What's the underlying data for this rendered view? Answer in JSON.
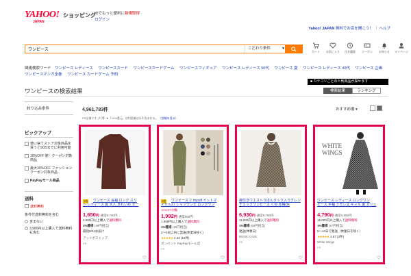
{
  "header": {
    "logo_text": "YAHOO!",
    "logo_sub": "JAPAN",
    "shop_label": "ショッピング",
    "login_prompt": "IDでもっと便利に",
    "register_link": "新規取得",
    "login_link": "ログイン",
    "yj_label": "Yahoo! JAPAN",
    "top_links": "無料でお店を開こう！",
    "help": "ヘルプ"
  },
  "search": {
    "value": "ワンピース",
    "condition_label": "こだわり条件",
    "icons": [
      {
        "icon": "cart-icon",
        "label": "カート"
      },
      {
        "icon": "heart-icon",
        "label": "お気に入り"
      },
      {
        "icon": "history-icon",
        "label": "注文履歴"
      },
      {
        "icon": "coupon-icon",
        "label": "クーポン"
      },
      {
        "icon": "bell-icon",
        "label": "お知らせ"
      },
      {
        "icon": "user-icon",
        "label": "マイページ"
      }
    ]
  },
  "related": {
    "label": "関連検索ワード",
    "words": [
      "ワンピース レディース",
      "ワンピースカード",
      "ワンピースカードゲーム",
      "ワンピースフィギュア",
      "ワンピース レディース 50代",
      "ワンピース 夏",
      "ワンピース レディース 40代",
      "ワンピース 企画",
      "ワンピースマンガ全巻",
      "ワンピース カードゲーム 予約"
    ]
  },
  "page": {
    "title": "ワンピースの検索結果",
    "notice": "カテゴリごとの人気商品が探せます",
    "tabs": [
      "検索結果",
      "ランキング"
    ],
    "count": "4,961,783件",
    "sort": "おすすめ順",
    "pr_line": "PR企業です | 行等: ★「10%還元」は利用者は分不含まれる。",
    "pr_line2": "（詳細を見る）"
  },
  "sidebar": {
    "filter_title": "絞り込み条件",
    "pickup_title": "ピックアップ",
    "pickup_items": [
      "使い捨てストア対象商品を買うと9/25までに利用可能",
      "10%OFF 使！クーポン対象商品",
      "最大30%OFF ファッションクーポン対象商品"
    ],
    "paypay": "PayPayモール商品",
    "ship_title": "送料",
    "ship_free": "送料無料",
    "ship_condition": "条件付送料無料を含む",
    "radio_items": [
      "含まない",
      "3,980円以上購入で送料無料も含む"
    ]
  },
  "products": [
    {
      "badge1": "1倍",
      "badge2": "送料",
      "title_line1": "ワンピース 長袖 ロング スリ",
      "title_line2": "ト レディース 夏 大人 きれいめ セー",
      "price": "1,650",
      "price_unit": "円",
      "was": "通常6,700円",
      "ship": "3,980円以上購入で",
      "ship_free": "送料無料",
      "points": "3%獲得",
      "points_detail": "(49円相当)",
      "delivery": "最短9/24お届け",
      "rating_stars": "",
      "rating_value": "",
      "rating_count": "",
      "store": "アッドボストップ",
      "pr": "PR"
    },
    {
      "badge1": "1倍",
      "badge2": "送料",
      "sale": "10%OFF対象",
      "title_line1": "ワンピース 1: mysdf イットマ",
      "title_line2": "イセル2 / シャツワンピ ロングワン",
      "price": "1,992",
      "price_unit": "円",
      "was": "通常850円",
      "ship": "1,999円以上購入で",
      "ship_free": "送料無料",
      "points": "1%獲得",
      "points_detail": "(19円相当)",
      "delivery": "2〜3日以内に発送(休業日除く)",
      "rating_stars": "★★★★★",
      "rating_value": "4.43",
      "rating_count": "(16件)",
      "store": "ポンペント PayPayモール店",
      "pr": "PR"
    },
    {
      "badge1": "",
      "badge2": "",
      "title_line1": "襟付きウエストりぼんタック入りグレン",
      "title_line2": "チェックワンピース ＜ゆ 本格Ok",
      "price": "6,930",
      "price_unit": "円",
      "was": "通常9,790円",
      "ship": "11,000円以上購入で",
      "ship_free": "送料無料",
      "points": "1%獲得",
      "points_detail": "(69円相当)",
      "delivery": "発送(休業日)",
      "rating_stars": "",
      "rating_value": "",
      "rating_count": "",
      "store": "BOOK CAVE",
      "pr": "PR"
    },
    {
      "badge1": "",
      "badge2": "",
      "title_line1": "ワンピース レディース ロングワン",
      "title_line2": "ピース 半袖 ミモレ丈 ギャル 夏 カジュ",
      "price": "4,790",
      "price_unit": "円",
      "was": "通常6,990円",
      "ship": "15,000円以上購入で",
      "ship_free": "送料無料",
      "points": "1%獲得",
      "points_detail": "(47円相当)",
      "delivery": "5〜10日で発送（休業日を除く）",
      "rating_stars": "★★★★★",
      "rating_value": "4.67",
      "rating_count": "(3件)",
      "store": "White Wings",
      "pr": "PR"
    }
  ],
  "colors": {
    "yahoo_red": "#ff0033",
    "accent_orange": "#ff7b00",
    "highlight_border": "#e4004b",
    "link_blue": "#1a3cbb"
  }
}
